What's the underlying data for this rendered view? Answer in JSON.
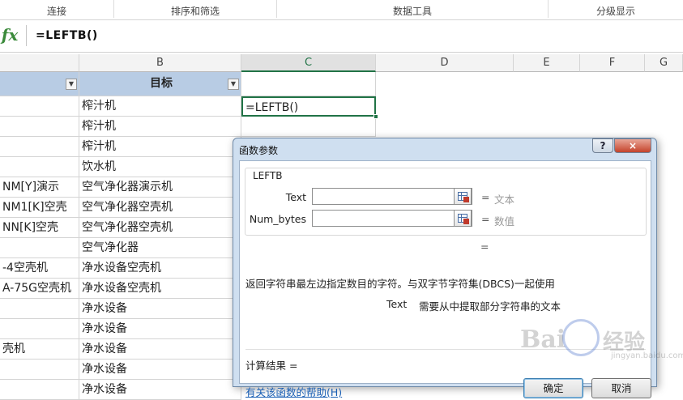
{
  "ribbon": {
    "groups": [
      "连接",
      "排序和筛选",
      "数据工具",
      "分级显示"
    ]
  },
  "formula_bar": {
    "fx_label": "fx",
    "formula": "=LEFTB()"
  },
  "columns": [
    "B",
    "C",
    "D",
    "E",
    "F",
    "G"
  ],
  "active_column": "C",
  "header_row": {
    "b": "目标"
  },
  "rows": [
    {
      "a": "",
      "b": "榨汁机",
      "c": "=LEFTB()"
    },
    {
      "a": "",
      "b": "榨汁机",
      "c": ""
    },
    {
      "a": "",
      "b": "榨汁机",
      "c": ""
    },
    {
      "a": "",
      "b": "饮水机",
      "c": ""
    },
    {
      "a": "NM[Y]演示",
      "b": "空气净化器演示机",
      "c": ""
    },
    {
      "a": "NM1[K]空壳",
      "b": "空气净化器空壳机",
      "c": ""
    },
    {
      "a": "NN[K]空壳",
      "b": "空气净化器空壳机",
      "c": ""
    },
    {
      "a": "",
      "b": "空气净化器",
      "c": ""
    },
    {
      "a": "-4空壳机",
      "b": "净水设备空壳机",
      "c": ""
    },
    {
      "a": "A-75G空壳机",
      "b": "净水设备空壳机",
      "c": ""
    },
    {
      "a": "",
      "b": "净水设备",
      "c": ""
    },
    {
      "a": "",
      "b": "净水设备",
      "c": ""
    },
    {
      "a": "壳机",
      "b": "净水设备",
      "c": ""
    },
    {
      "a": "",
      "b": "净水设备",
      "c": ""
    },
    {
      "a": "",
      "b": "净水设备",
      "c": ""
    }
  ],
  "dialog": {
    "title": "函数参数",
    "help_button": "?",
    "close_button": "×",
    "function_name": "LEFTB",
    "args": [
      {
        "label": "Text",
        "value": "",
        "eq": "=",
        "hint": "文本"
      },
      {
        "label": "Num_bytes",
        "value": "",
        "eq": "=",
        "hint": "数值"
      }
    ],
    "result_eq": "=",
    "description": "返回字符串最左边指定数目的字符。与双字节字符集(DBCS)一起使用",
    "arg_desc_name": "Text",
    "arg_desc_text": "需要从中提取部分字符串的文本",
    "result_label": "计算结果 =",
    "help_link": "有关该函数的帮助(H)",
    "ok_label": "确定",
    "cancel_label": "取消"
  },
  "watermark": {
    "brand": "Bai",
    "brand2": "经验",
    "url": "jingyan.baidu.com"
  }
}
